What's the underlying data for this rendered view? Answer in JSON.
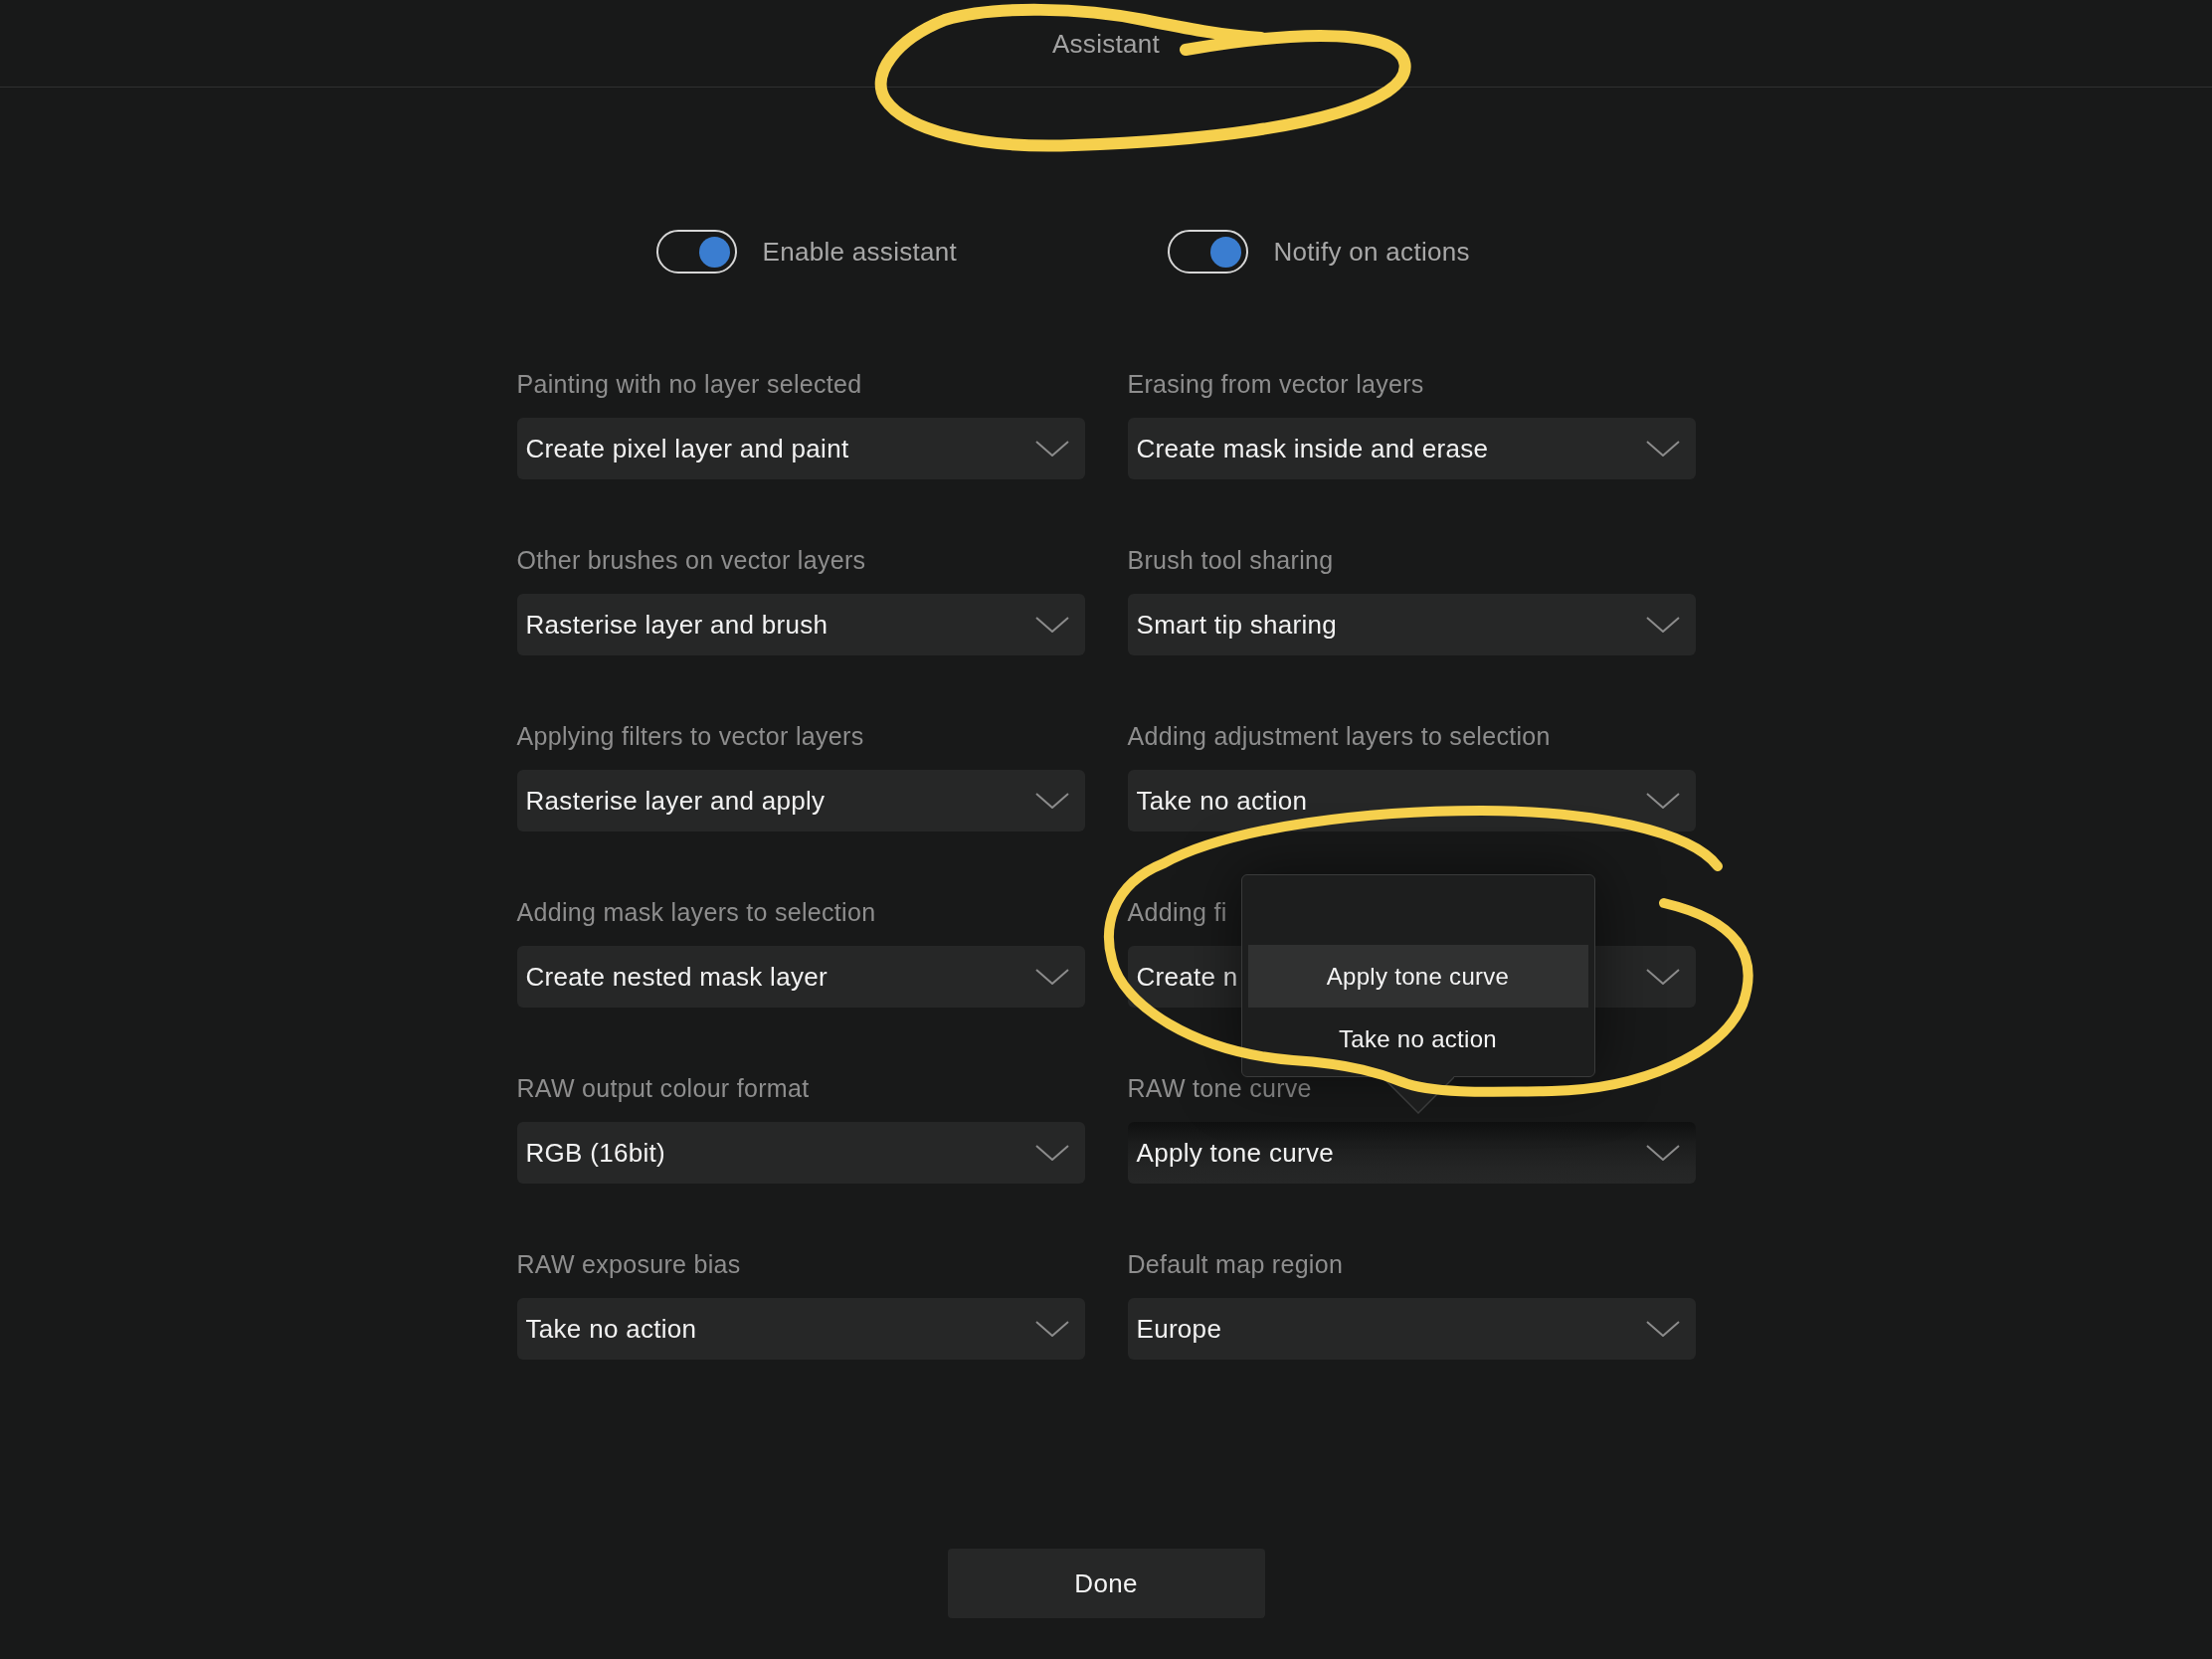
{
  "header": {
    "title": "Assistant"
  },
  "toggles": [
    {
      "label": "Enable assistant",
      "on": true
    },
    {
      "label": "Notify on actions",
      "on": true
    }
  ],
  "settings": [
    {
      "label": "Painting with no layer selected",
      "value": "Create pixel layer and paint",
      "expanded": false
    },
    {
      "label": "Erasing from vector layers",
      "value": "Create mask inside and erase",
      "expanded": false
    },
    {
      "label": "Other brushes on vector layers",
      "value": "Rasterise layer and brush",
      "expanded": false
    },
    {
      "label": "Brush tool sharing",
      "value": "Smart tip sharing",
      "expanded": false
    },
    {
      "label": "Applying filters to vector layers",
      "value": "Rasterise layer and apply",
      "expanded": false
    },
    {
      "label": "Adding adjustment layers to selection",
      "value": "Take no action",
      "expanded": false
    },
    {
      "label": "Adding mask layers to selection",
      "value": "Create nested mask layer",
      "expanded": false
    },
    {
      "label": "Adding fi",
      "value": "Create n",
      "expanded": false
    },
    {
      "label": "RAW output colour format",
      "value": "RGB (16bit)",
      "expanded": false
    },
    {
      "label": "RAW tone curve",
      "value": "Apply tone curve",
      "expanded": true,
      "options": [
        {
          "label": "Apply tone curve",
          "selected": true
        },
        {
          "label": "Take no action",
          "selected": false
        }
      ]
    },
    {
      "label": "RAW exposure bias",
      "value": "Take no action",
      "expanded": false
    },
    {
      "label": "Default map region",
      "value": "Europe",
      "expanded": false
    }
  ],
  "done_button": {
    "label": "Done"
  }
}
